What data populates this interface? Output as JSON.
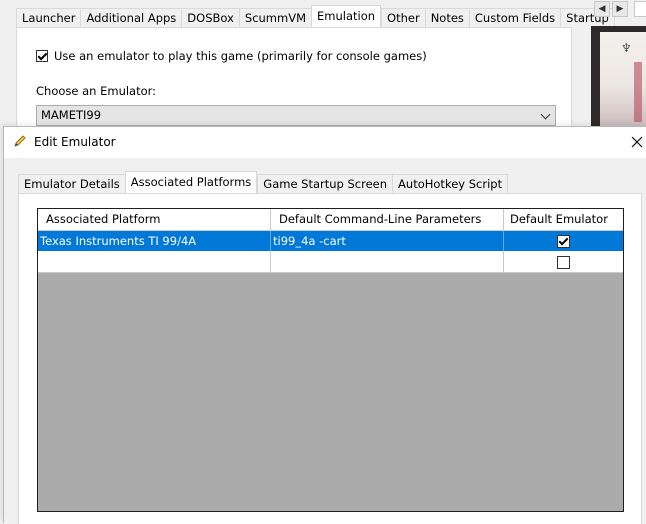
{
  "background_window": {
    "tabs": [
      {
        "label": "Launcher",
        "active": false
      },
      {
        "label": "Additional Apps",
        "active": false
      },
      {
        "label": "DOSBox",
        "active": false
      },
      {
        "label": "ScummVM",
        "active": false
      },
      {
        "label": "Emulation",
        "active": true
      },
      {
        "label": "Other",
        "active": false
      },
      {
        "label": "Notes",
        "active": false
      },
      {
        "label": "Custom Fields",
        "active": false
      },
      {
        "label": "Startup",
        "active": false
      }
    ],
    "use_emulator_checkbox": {
      "label": "Use an emulator to play this game (primarily for console games)",
      "checked": true
    },
    "choose_emulator_label": "Choose an Emulator:",
    "emulator_select_value": "MAMETI99",
    "nav_prev": "◀",
    "nav_next": "▶"
  },
  "dialog": {
    "title": "Edit Emulator",
    "tabs": [
      {
        "label": "Emulator Details",
        "active": false
      },
      {
        "label": "Associated Platforms",
        "active": true
      },
      {
        "label": "Game Startup Screen",
        "active": false
      },
      {
        "label": "AutoHotkey Script",
        "active": false
      }
    ],
    "grid": {
      "columns": [
        "Associated Platform",
        "Default Command-Line Parameters",
        "Default Emulator"
      ],
      "rows": [
        {
          "platform": "Texas Instruments TI 99/4A",
          "params": "ti99_4a -cart",
          "default": true,
          "selected": true
        },
        {
          "platform": "",
          "params": "",
          "default": false,
          "selected": false
        }
      ]
    }
  },
  "colors": {
    "selection": "#0078d7",
    "grid_empty": "#ababab",
    "window_bg": "#f0f0f0"
  },
  "icons": {
    "title_icon": "pencil-icon",
    "close_icon": "close-icon",
    "select_icon": "chevron-down-icon"
  }
}
